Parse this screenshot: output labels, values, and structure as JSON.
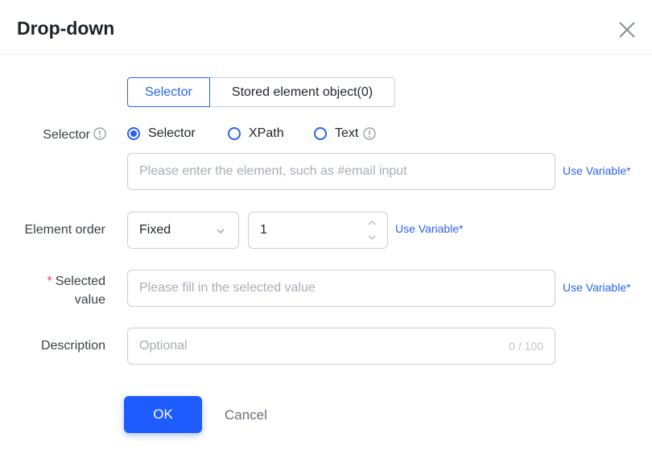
{
  "dialog": {
    "title": "Drop-down"
  },
  "tabs": {
    "selector": "Selector",
    "stored": "Stored element object(0)"
  },
  "selector_row": {
    "label": "Selector",
    "options": [
      "Selector",
      "XPath",
      "Text"
    ],
    "selected": "Selector",
    "input_placeholder": "Please enter the element, such as #email input",
    "use_variable": "Use Variable*"
  },
  "element_order": {
    "label": "Element order",
    "mode": "Fixed",
    "value": "1",
    "use_variable": "Use Variable*"
  },
  "selected_value": {
    "required_mark": "*",
    "label_line1": "Selected",
    "label_line2": "value",
    "placeholder": "Please fill in the selected value",
    "use_variable": "Use Variable*"
  },
  "description": {
    "label": "Description",
    "placeholder": "Optional",
    "counter": "0 / 100"
  },
  "footer": {
    "ok": "OK",
    "cancel": "Cancel"
  },
  "colors": {
    "accent": "#2a62f0",
    "primary_button": "#1f5cff"
  }
}
